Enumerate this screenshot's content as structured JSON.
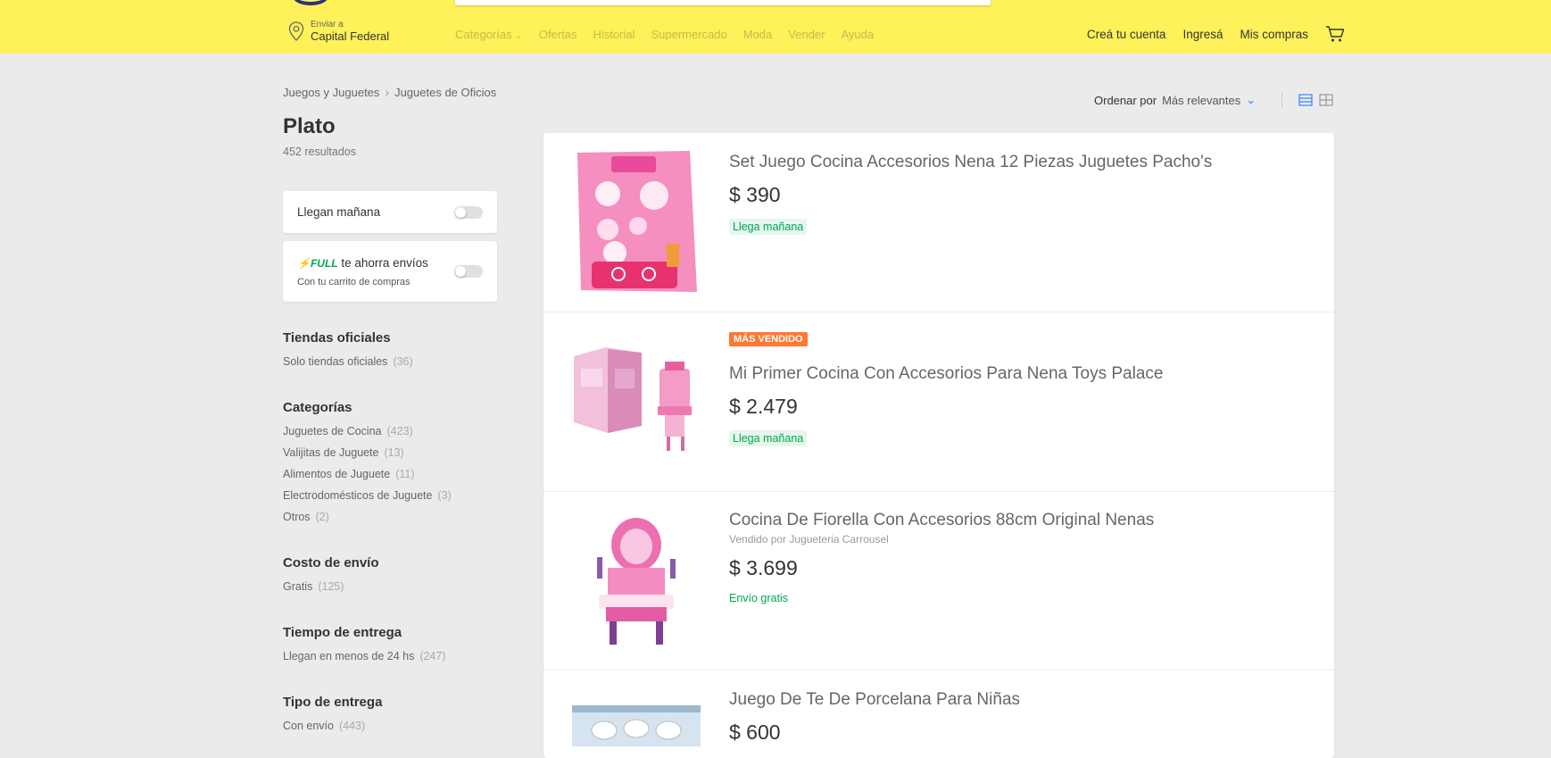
{
  "header": {
    "location_small": "Enviar a",
    "location": "Capital Federal",
    "nav": [
      "Categorías",
      "Ofertas",
      "Historial",
      "Supermercado",
      "Moda",
      "Vender",
      "Ayuda"
    ],
    "user_nav": [
      "Creá tu cuenta",
      "Ingresá",
      "Mis compras"
    ]
  },
  "breadcrumb": [
    "Juegos y Juguetes",
    "Juguetes de Oficios"
  ],
  "search": {
    "title": "Plato",
    "results": "452 resultados"
  },
  "filters": {
    "tomorrow": "Llegan mañana",
    "full_brand": "FULL",
    "full_label": "te ahorra envíos",
    "full_sub": "Con tu carrito de compras"
  },
  "facets": [
    {
      "title": "Tiendas oficiales",
      "items": [
        {
          "label": "Solo tiendas oficiales",
          "count": "(36)"
        }
      ]
    },
    {
      "title": "Categorías",
      "items": [
        {
          "label": "Juguetes de Cocina",
          "count": "(423)"
        },
        {
          "label": "Valijitas de Juguete",
          "count": "(13)"
        },
        {
          "label": "Alimentos de Juguete",
          "count": "(11)"
        },
        {
          "label": "Electrodomésticos de Juguete",
          "count": "(3)"
        },
        {
          "label": "Otros",
          "count": "(2)"
        }
      ]
    },
    {
      "title": "Costo de envío",
      "items": [
        {
          "label": "Gratis",
          "count": "(125)"
        }
      ]
    },
    {
      "title": "Tiempo de entrega",
      "items": [
        {
          "label": "Llegan en menos de 24 hs",
          "count": "(247)"
        }
      ]
    },
    {
      "title": "Tipo de entrega",
      "items": [
        {
          "label": "Con envío",
          "count": "(443)"
        }
      ]
    }
  ],
  "sort": {
    "label": "Ordenar por",
    "value": "Más relevantes"
  },
  "items": [
    {
      "title": "Set Juego Cocina Accesorios Nena 12 Piezas Juguetes Pacho's",
      "price": "$ 390",
      "shipping": "Llega mañana"
    },
    {
      "badge": "MÁS VENDIDO",
      "title": "Mi Primer Cocina Con Accesorios Para Nena Toys Palace",
      "price": "$ 2.479",
      "shipping": "Llega mañana"
    },
    {
      "title": "Cocina De Fiorella Con Accesorios 88cm Original Nenas",
      "seller": "Vendido por Jugueteria Carrousel",
      "price": "$ 3.699",
      "shipping": "Envío gratis"
    },
    {
      "title": "Juego De Te De Porcelana Para Niñas",
      "price": "$ 600"
    }
  ],
  "colors": {
    "header_bg": "#fff159",
    "accent_blue": "#3483fa",
    "shipping_green": "#00a650",
    "best_seller_orange": "#ff7733"
  }
}
